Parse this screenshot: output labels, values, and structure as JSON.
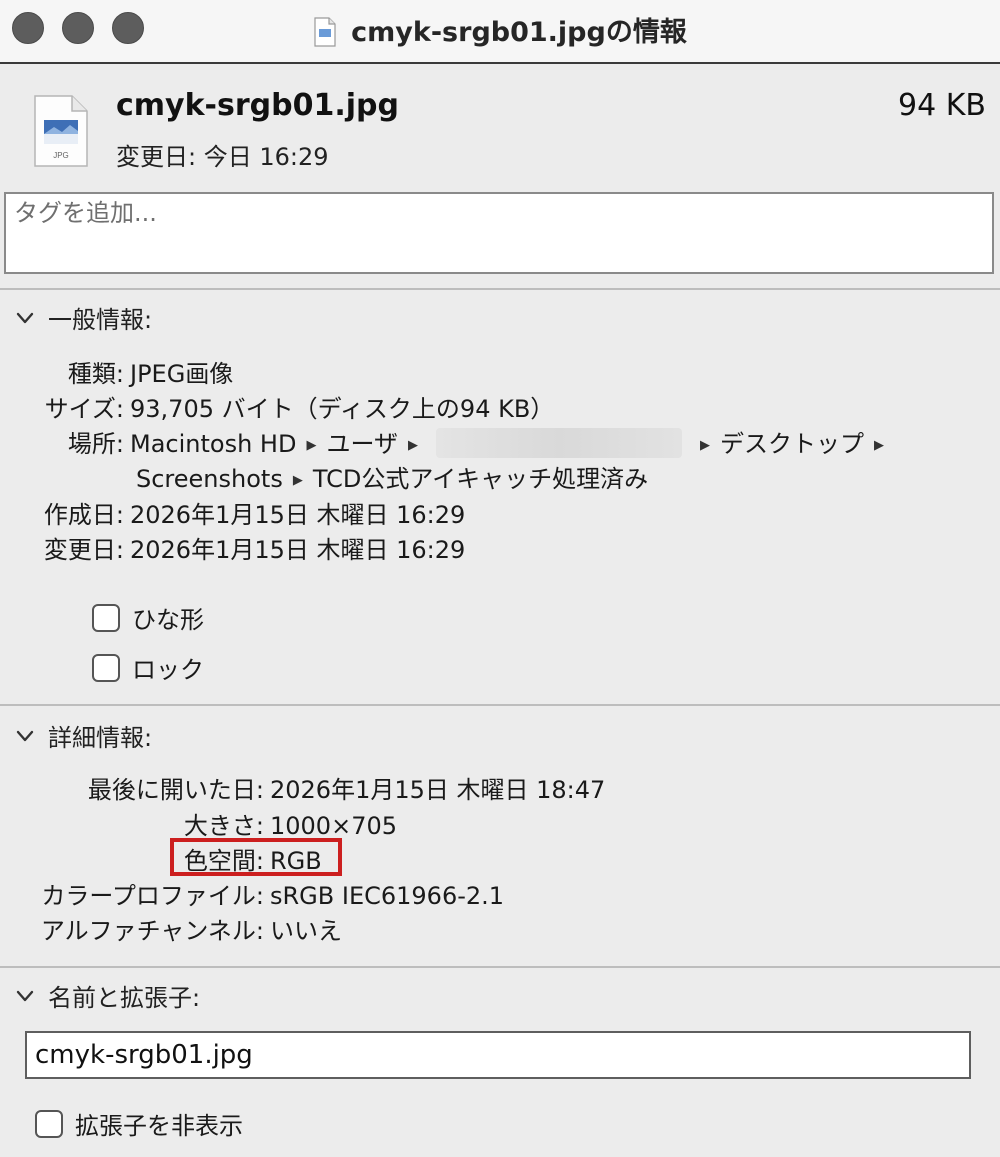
{
  "window": {
    "title": "cmyk-srgb01.jpgの情報"
  },
  "header": {
    "file_name": "cmyk-srgb01.jpg",
    "modified": "変更日: 今日 16:29",
    "size": "94 KB",
    "icon_label": "JPG"
  },
  "tags": {
    "placeholder": "タグを追加..."
  },
  "general": {
    "title": "一般情報:",
    "rows": [
      {
        "label": "種類:",
        "value": "JPEG画像"
      },
      {
        "label": "サイズ:",
        "value": "93,705 バイト（ディスク上の94 KB）"
      },
      {
        "label": "場所:",
        "path1": [
          "Macintosh HD",
          "ユーザ"
        ],
        "path1_end": "デスクトップ",
        "path2": [
          "Screenshots",
          "TCD公式アイキャッチ処理済み"
        ]
      },
      {
        "label": "作成日:",
        "value": "2026年1月15日 木曜日 16:29"
      },
      {
        "label": "変更日:",
        "value": "2026年1月15日 木曜日 16:29"
      }
    ],
    "stationery_label": "ひな形",
    "locked_label": "ロック"
  },
  "details": {
    "title": "詳細情報:",
    "rows": [
      {
        "label": "最後に開いた日:",
        "value": "2026年1月15日 木曜日 18:47"
      },
      {
        "label": "大きさ:",
        "value": "1000×705"
      },
      {
        "label": "色空間:",
        "value": "RGB"
      },
      {
        "label": "カラープロファイル:",
        "value": "sRGB IEC61966-2.1"
      },
      {
        "label": "アルファチャンネル:",
        "value": "いいえ"
      }
    ]
  },
  "name_ext": {
    "title": "名前と拡張子:",
    "value": "cmyk-srgb01.jpg",
    "hide_ext_label": "拡張子を非表示"
  },
  "colors": {
    "highlight": "#cc1f1f"
  }
}
